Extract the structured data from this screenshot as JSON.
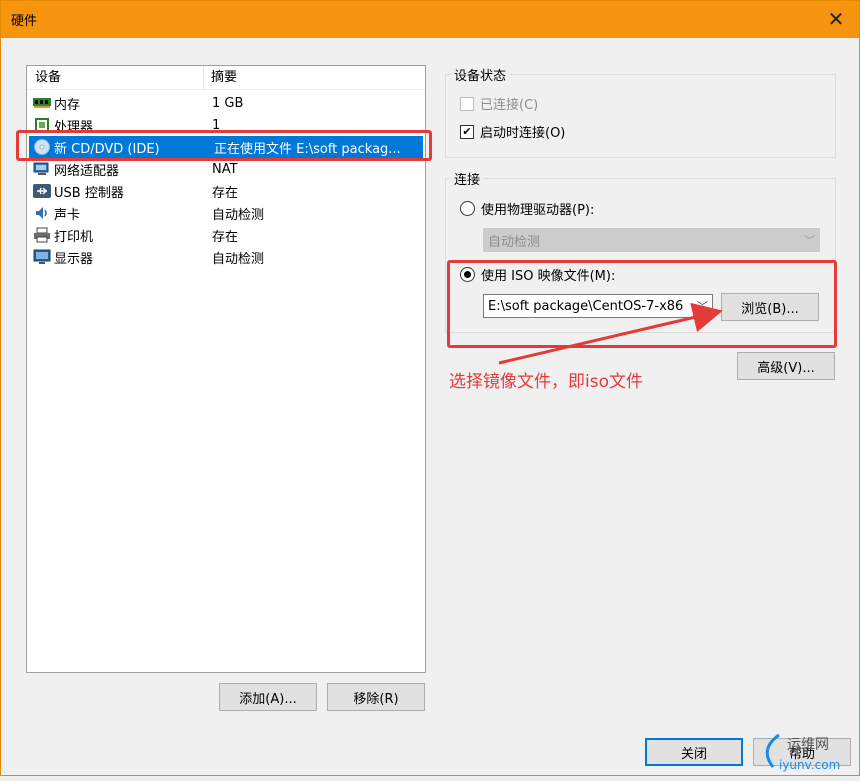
{
  "window": {
    "title": "硬件",
    "close_glyph": "✕"
  },
  "device_list": {
    "headers": {
      "device": "设备",
      "summary": "摘要"
    },
    "rows": [
      {
        "device": "内存",
        "summary": "1 GB",
        "icon": "memory-icon"
      },
      {
        "device": "处理器",
        "summary": "1",
        "icon": "cpu-icon"
      },
      {
        "device": "新 CD/DVD (IDE)",
        "summary": "正在使用文件 E:\\soft packag...",
        "icon": "cd-dvd-icon",
        "selected": true
      },
      {
        "device": "网络适配器",
        "summary": "NAT",
        "icon": "network-adapter-icon"
      },
      {
        "device": "USB 控制器",
        "summary": "存在",
        "icon": "usb-icon"
      },
      {
        "device": "声卡",
        "summary": "自动检测",
        "icon": "sound-card-icon"
      },
      {
        "device": "打印机",
        "summary": "存在",
        "icon": "printer-icon"
      },
      {
        "device": "显示器",
        "summary": "自动检测",
        "icon": "display-icon"
      }
    ],
    "add_button": "添加(A)...",
    "remove_button": "移除(R)"
  },
  "device_status": {
    "title": "设备状态",
    "connected": {
      "label": "已连接(C)",
      "checked": false,
      "disabled": true
    },
    "connect_at_power_on": {
      "label": "启动时连接(O)",
      "checked": true
    }
  },
  "connection": {
    "title": "连接",
    "physical_drive": {
      "label": "使用物理驱动器(P):",
      "selected": false,
      "dropdown_value": "自动检测"
    },
    "iso_image": {
      "label": "使用 ISO 映像文件(M):",
      "selected": true,
      "path_value": "E:\\soft package\\CentOS-7-x86",
      "browse_button": "浏览(B)..."
    }
  },
  "advanced_button": "高级(V)...",
  "annotation": "选择镜像文件，即iso文件",
  "footer": {
    "close_button": "关闭",
    "help_button": "帮助"
  },
  "watermark": {
    "line1": "运维网",
    "line2": "iyunv.com"
  },
  "colors": {
    "titlebar": "#f7940f",
    "selection": "#0078d7",
    "annotation": "#e53a3a"
  }
}
